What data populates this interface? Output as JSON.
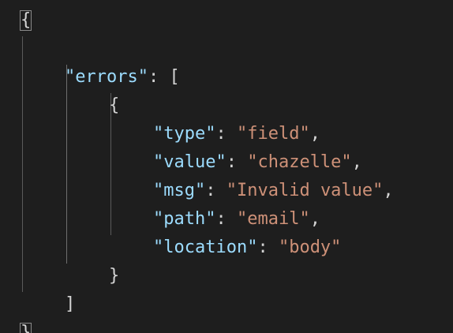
{
  "editor": {
    "lines": [
      {
        "indent": 0,
        "parts": [
          {
            "t": "{",
            "c": "punc brace-match"
          }
        ]
      },
      {
        "indent": 0,
        "parts": []
      },
      {
        "indent": 1,
        "parts": [
          {
            "t": "\"errors\"",
            "c": "key"
          },
          {
            "t": ": [",
            "c": "punc"
          }
        ]
      },
      {
        "indent": 2,
        "parts": [
          {
            "t": "{",
            "c": "punc"
          }
        ]
      },
      {
        "indent": 3,
        "parts": [
          {
            "t": "\"type\"",
            "c": "key"
          },
          {
            "t": ": ",
            "c": "punc"
          },
          {
            "t": "\"field\"",
            "c": "str"
          },
          {
            "t": ",",
            "c": "punc"
          }
        ]
      },
      {
        "indent": 3,
        "parts": [
          {
            "t": "\"value\"",
            "c": "key"
          },
          {
            "t": ": ",
            "c": "punc"
          },
          {
            "t": "\"chazelle\"",
            "c": "str"
          },
          {
            "t": ",",
            "c": "punc"
          }
        ]
      },
      {
        "indent": 3,
        "parts": [
          {
            "t": "\"msg\"",
            "c": "key"
          },
          {
            "t": ": ",
            "c": "punc"
          },
          {
            "t": "\"Invalid value\"",
            "c": "str"
          },
          {
            "t": ",",
            "c": "punc"
          }
        ]
      },
      {
        "indent": 3,
        "parts": [
          {
            "t": "\"path\"",
            "c": "key"
          },
          {
            "t": ": ",
            "c": "punc"
          },
          {
            "t": "\"email\"",
            "c": "str"
          },
          {
            "t": ",",
            "c": "punc"
          }
        ]
      },
      {
        "indent": 3,
        "parts": [
          {
            "t": "\"location\"",
            "c": "key"
          },
          {
            "t": ": ",
            "c": "punc"
          },
          {
            "t": "\"body\"",
            "c": "str"
          }
        ]
      },
      {
        "indent": 2,
        "parts": [
          {
            "t": "}",
            "c": "punc"
          }
        ]
      },
      {
        "indent": 1,
        "parts": [
          {
            "t": "]",
            "c": "punc"
          }
        ]
      },
      {
        "indent": 0,
        "parts": [
          {
            "t": "}",
            "c": "punc brace-match"
          }
        ]
      }
    ],
    "colors": {
      "background": "#1e1e1e",
      "key": "#9cdcfe",
      "string": "#ce9178",
      "punctuation": "#d4d4d4",
      "indent_guide": "#5a5a5a"
    }
  }
}
